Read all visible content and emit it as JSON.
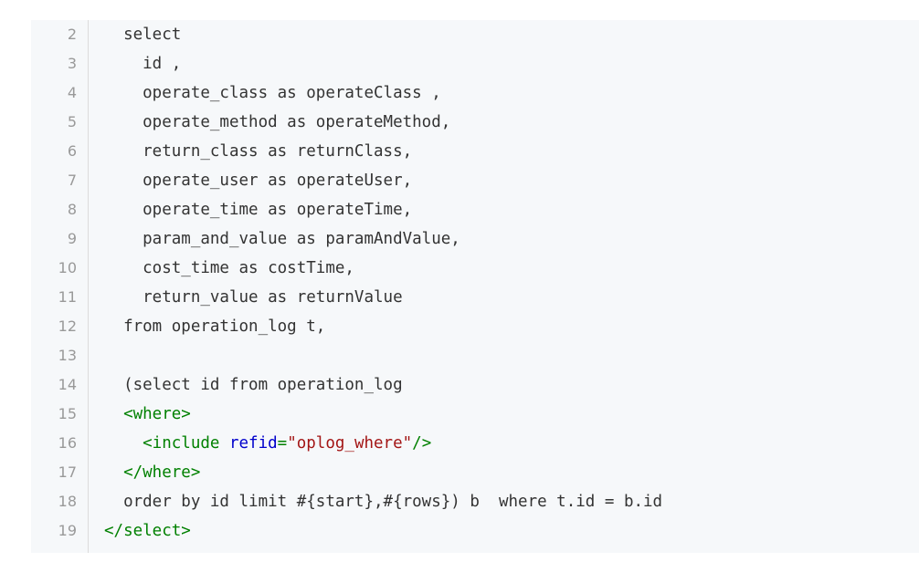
{
  "code": {
    "lines": [
      {
        "no": "2",
        "parts": [
          {
            "t": "  select",
            "c": "plain"
          }
        ]
      },
      {
        "no": "3",
        "parts": [
          {
            "t": "    id ,",
            "c": "plain"
          }
        ]
      },
      {
        "no": "4",
        "parts": [
          {
            "t": "    operate_class as operateClass ,",
            "c": "plain"
          }
        ]
      },
      {
        "no": "5",
        "parts": [
          {
            "t": "    operate_method as operateMethod,",
            "c": "plain"
          }
        ]
      },
      {
        "no": "6",
        "parts": [
          {
            "t": "    return_class as returnClass,",
            "c": "plain"
          }
        ]
      },
      {
        "no": "7",
        "parts": [
          {
            "t": "    operate_user as operateUser,",
            "c": "plain"
          }
        ]
      },
      {
        "no": "8",
        "parts": [
          {
            "t": "    operate_time as operateTime,",
            "c": "plain"
          }
        ]
      },
      {
        "no": "9",
        "parts": [
          {
            "t": "    param_and_value as paramAndValue,",
            "c": "plain"
          }
        ]
      },
      {
        "no": "10",
        "parts": [
          {
            "t": "    cost_time as costTime,",
            "c": "plain"
          }
        ]
      },
      {
        "no": "11",
        "parts": [
          {
            "t": "    return_value as returnValue",
            "c": "plain"
          }
        ]
      },
      {
        "no": "12",
        "parts": [
          {
            "t": "  from operation_log t,",
            "c": "plain"
          }
        ]
      },
      {
        "no": "13",
        "parts": [
          {
            "t": "",
            "c": "plain"
          }
        ]
      },
      {
        "no": "14",
        "parts": [
          {
            "t": "  (select id from operation_log",
            "c": "plain"
          }
        ]
      },
      {
        "no": "15",
        "parts": [
          {
            "t": "  <where>",
            "c": "tag"
          }
        ]
      },
      {
        "no": "16",
        "parts": [
          {
            "t": "    <include ",
            "c": "tag"
          },
          {
            "t": "refid",
            "c": "attr"
          },
          {
            "t": "=",
            "c": "tag"
          },
          {
            "t": "\"oplog_where\"",
            "c": "str"
          },
          {
            "t": "/>",
            "c": "tag"
          }
        ]
      },
      {
        "no": "17",
        "parts": [
          {
            "t": "  </where>",
            "c": "tag"
          }
        ]
      },
      {
        "no": "18",
        "parts": [
          {
            "t": "  order by id limit #{start},#{rows}) b  where t.id = b.id",
            "c": "plain"
          }
        ]
      },
      {
        "no": "19",
        "parts": [
          {
            "t": "</select>",
            "c": "tag"
          }
        ]
      }
    ]
  }
}
